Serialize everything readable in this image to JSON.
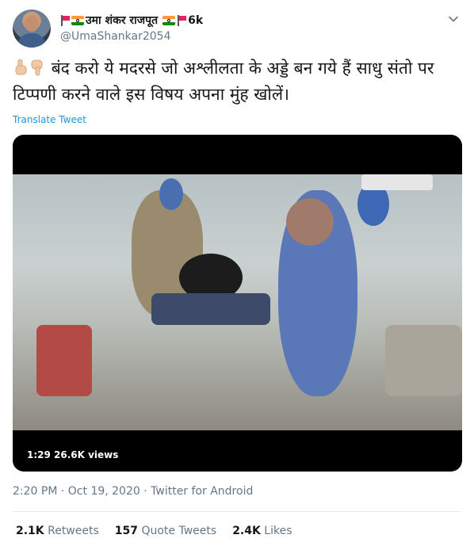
{
  "author": {
    "display_name": "उमा शंकर राजपूत",
    "name_suffix": "6k",
    "handle": "@UmaShankar2054",
    "icons": [
      "red-flag-icon",
      "india-flag-icon",
      "india-flag-icon",
      "red-flag-icon"
    ]
  },
  "tweet": {
    "text": "बंद करो ये मदरसे जो अश्लीलता के अड्डे बन गये हैं साधु संतो पर टिप्पणी करने वाले इस विषय अपना मुंह खोलें।",
    "leading_icons": [
      "finger-up-icon",
      "finger-down-icon"
    ],
    "translate_label": "Translate Tweet"
  },
  "video": {
    "duration": "1:29",
    "views": "26.6K views"
  },
  "meta": {
    "time": "2:20 PM",
    "separator": "·",
    "date": "Oct 19, 2020",
    "source": "Twitter for Android"
  },
  "stats": {
    "retweets_count": "2.1K",
    "retweets_label": "Retweets",
    "quotes_count": "157",
    "quotes_label": "Quote Tweets",
    "likes_count": "2.4K",
    "likes_label": "Likes"
  },
  "colors": {
    "link": "#1b95e0",
    "secondary_text": "#657786",
    "primary_text": "#14171a",
    "divider": "#e6ecf0"
  }
}
